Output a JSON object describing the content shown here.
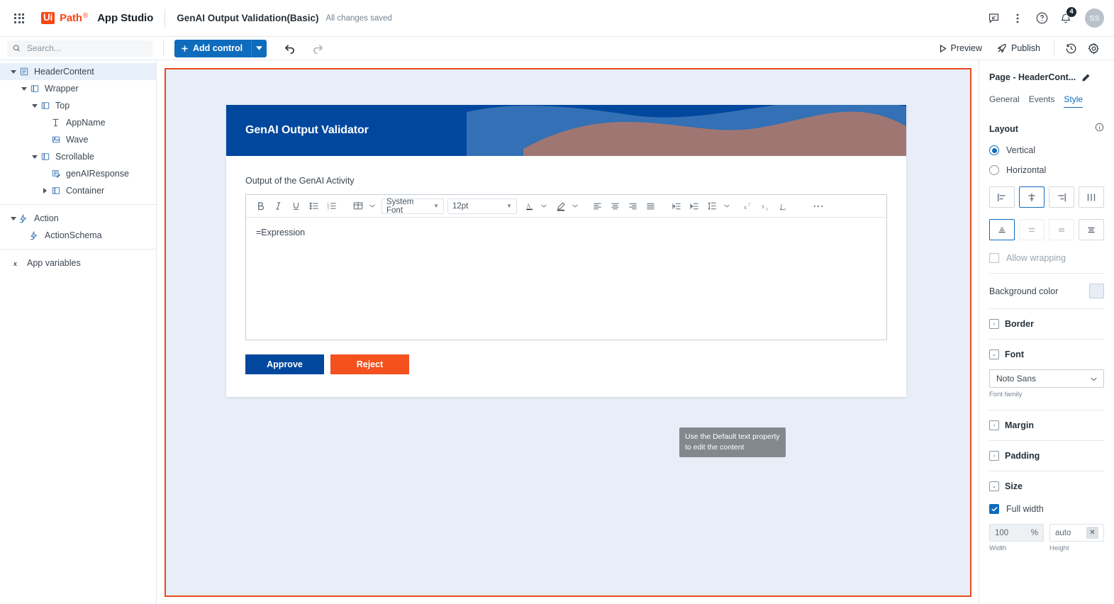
{
  "topbar": {
    "waffle_icon": "apps-grid-icon",
    "brand_ui": "Ui",
    "brand_path": "Path",
    "brand_product": "App Studio",
    "project_name": "GenAI Output Validation(Basic)",
    "save_status": "All changes saved",
    "feedback_icon": "feedback-icon",
    "more_icon": "more-vertical-icon",
    "help_icon": "help-circle-icon",
    "notifications_icon": "bell-icon",
    "notification_count": "4",
    "avatar_initials": "SS"
  },
  "toolbar": {
    "search_placeholder": "Search...",
    "search_value": "",
    "add_control_label": "Add control",
    "undo_icon": "undo-icon",
    "redo_icon": "redo-icon",
    "preview_label": "Preview",
    "publish_label": "Publish",
    "history_icon": "history-icon",
    "settings_icon": "gear-icon"
  },
  "tree": {
    "groups": [
      {
        "nodes": [
          {
            "label": "HeaderContent",
            "depth": 0,
            "expanded": true,
            "selected": true,
            "icon": "page-icon",
            "chevron": "down"
          },
          {
            "label": "Wrapper",
            "depth": 1,
            "expanded": true,
            "selected": false,
            "icon": "container-icon",
            "chevron": "down"
          },
          {
            "label": "Top",
            "depth": 2,
            "expanded": true,
            "selected": false,
            "icon": "container-icon",
            "chevron": "down"
          },
          {
            "label": "AppName",
            "depth": 3,
            "expanded": false,
            "selected": false,
            "icon": "text-icon",
            "chevron": "none"
          },
          {
            "label": "Wave",
            "depth": 3,
            "expanded": false,
            "selected": false,
            "icon": "image-icon",
            "chevron": "none"
          },
          {
            "label": "Scrollable",
            "depth": 2,
            "expanded": true,
            "selected": false,
            "icon": "container-icon",
            "chevron": "down"
          },
          {
            "label": "genAIResponse",
            "depth": 3,
            "expanded": false,
            "selected": false,
            "icon": "richtext-icon",
            "chevron": "none"
          },
          {
            "label": "Container",
            "depth": 2,
            "expanded": false,
            "selected": false,
            "icon": "container-icon",
            "chevron": "right"
          }
        ]
      },
      {
        "nodes": [
          {
            "label": "Action",
            "depth": 0,
            "expanded": true,
            "selected": false,
            "icon": "action-icon",
            "chevron": "down"
          },
          {
            "label": "ActionSchema",
            "depth": 1,
            "expanded": false,
            "selected": false,
            "icon": "action-icon",
            "chevron": "none"
          }
        ]
      },
      {
        "nodes": [
          {
            "label": "App variables",
            "depth": 0,
            "expanded": false,
            "selected": false,
            "icon": "variable-icon",
            "chevron": "none"
          }
        ]
      }
    ]
  },
  "app_preview": {
    "header_title": "GenAI Output Validator",
    "field_label": "Output of the GenAI Activity",
    "editor": {
      "bold_icon": "bold-icon",
      "italic_icon": "italic-icon",
      "underline_icon": "underline-icon",
      "bullet_list_icon": "bullet-list-icon",
      "numbered_list_icon": "numbered-list-icon",
      "table_icon": "table-icon",
      "font_family_value": "System Font",
      "font_size_value": "12pt",
      "font_color_icon": "font-color-icon",
      "highlight_color_icon": "highlight-color-icon",
      "align_left_icon": "align-left-icon",
      "align_center_icon": "align-center-icon",
      "align_right_icon": "align-right-icon",
      "align_justify_icon": "align-justify-icon",
      "outdent_icon": "outdent-icon",
      "indent_icon": "indent-icon",
      "line_height_icon": "line-height-icon",
      "superscript_icon": "superscript-icon",
      "subscript_icon": "subscript-icon",
      "clear_format_icon": "clear-format-icon",
      "more_icon": "more-horizontal-icon",
      "content_value": "=Expression"
    },
    "approve_label": "Approve",
    "reject_label": "Reject",
    "tooltip_text": "Use the Default text property to edit the content"
  },
  "properties": {
    "title": "Page - HeaderCont...",
    "edit_icon": "pencil-icon",
    "tabs": [
      {
        "label": "General",
        "active": false
      },
      {
        "label": "Events",
        "active": false
      },
      {
        "label": "Style",
        "active": true
      }
    ],
    "layout": {
      "section_label": "Layout",
      "info_icon": "info-icon",
      "vertical_label": "Vertical",
      "horizontal_label": "Horizontal",
      "vertical_selected": true,
      "horizontal_selected": false,
      "h_align_icons": [
        "align-start-icon",
        "align-center-icon",
        "align-end-icon",
        "align-stretch-icon"
      ],
      "h_align_selected_index": 1,
      "v_align_icons": [
        "justify-start-icon",
        "justify-center-icon",
        "justify-end-icon",
        "justify-between-icon"
      ],
      "v_align_selected_index": 0,
      "allow_wrapping_label": "Allow wrapping",
      "allow_wrapping_checked": false
    },
    "background": {
      "label": "Background color",
      "color": "#e8eef7"
    },
    "border": {
      "label": "Border",
      "expanded": false
    },
    "font": {
      "label": "Font",
      "expanded": true,
      "family_value": "Noto Sans",
      "family_sublabel": "Font family"
    },
    "margin": {
      "label": "Margin",
      "expanded": false
    },
    "padding": {
      "label": "Padding",
      "expanded": false
    },
    "size": {
      "label": "Size",
      "expanded": true,
      "full_width_label": "Full width",
      "full_width_checked": true,
      "width_value": "100",
      "width_unit": "%",
      "width_sublabel": "Width",
      "height_value": "auto",
      "height_sublabel": "Height",
      "height_clear_icon": "close-icon"
    }
  },
  "colors": {
    "brand_orange": "#fa4616",
    "primary_blue": "#0f6cbd",
    "app_header_blue": "#00479d",
    "reject_orange": "#f4511e",
    "canvas_border": "#e8491e",
    "canvas_bg": "#e8eef7",
    "wave_blue": "#3370b5",
    "wave_rose": "#a9766e"
  }
}
